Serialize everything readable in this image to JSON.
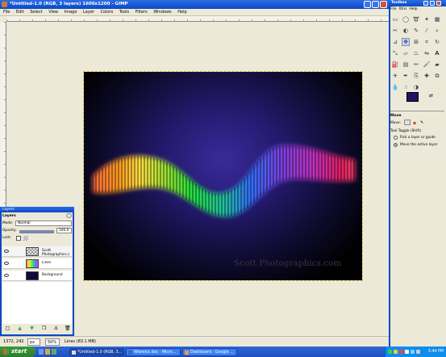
{
  "window": {
    "title": "*Untitled-1.0 (RGB, 3 layers) 1600x1200 - GIMP"
  },
  "menu": [
    "File",
    "Edit",
    "Select",
    "View",
    "Image",
    "Layer",
    "Colors",
    "Tools",
    "Filters",
    "Windows",
    "Help"
  ],
  "image": {
    "watermark": "Scott Photographics.com"
  },
  "statusbar": {
    "coords": "1372, 242",
    "unit": "px",
    "zoom": "50%",
    "info": "Lines (83.1 MB)"
  },
  "toolbox": {
    "title": "Toolbox",
    "menu": [
      "File",
      "Xtns",
      "Help"
    ],
    "fg_color": "#1e1466",
    "bg_color": "#ffffff",
    "options": {
      "tool_title": "Move",
      "move_label": "Move:",
      "toggle_label": "Tool Toggle  (Shift)",
      "radio1": "Pick a layer or guide",
      "radio2": "Move the active layer"
    }
  },
  "layers": {
    "title": "Layers",
    "heading": "Layers",
    "mode_label": "Mode:",
    "mode_value": "Normal",
    "opacity_label": "Opacity:",
    "opacity_value": "100.0",
    "lock_label": "Lock:",
    "items": [
      {
        "name": "Scott Photographics.c"
      },
      {
        "name": "Lines"
      },
      {
        "name": "Background"
      }
    ]
  },
  "taskbar": {
    "start": "start",
    "buttons": [
      {
        "label": "*Untitled-1.0 (RGB, 3..."
      },
      {
        "label": "Wierelut.doc - Micro..."
      },
      {
        "label": "Dashboard - Google ..."
      }
    ],
    "clock": "3:44 PM"
  }
}
